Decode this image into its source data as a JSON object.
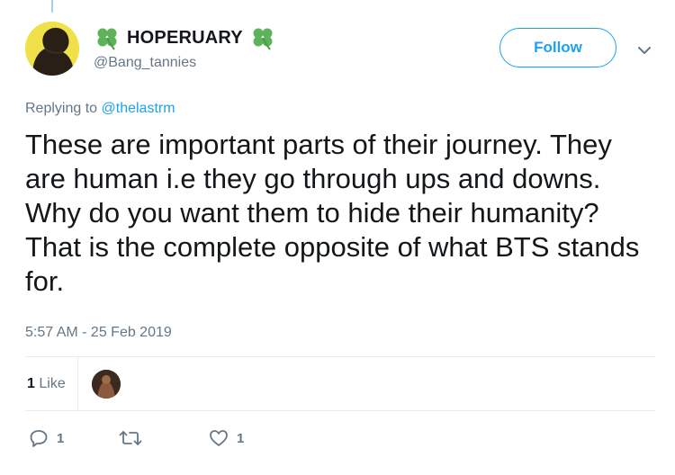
{
  "user": {
    "display_name": "HOPERUARY",
    "handle": "@Bang_tannies",
    "avatar_icon": "avatar-silhouette",
    "emoji_icon": "four-leaf-clover-icon"
  },
  "follow_button": {
    "label": "Follow"
  },
  "menu": {
    "icon": "chevron-down-icon"
  },
  "reply": {
    "prefix": "Replying to",
    "mention": "@thelastrm"
  },
  "tweet": {
    "text": "These are important parts of their journey. They are human i.e they go through ups and downs. Why do you want them to hide their humanity? That is the complete opposite of what BTS stands for.",
    "timestamp": "5:57 AM - 25 Feb 2019"
  },
  "likes": {
    "count": "1",
    "label": "Like"
  },
  "actions": {
    "reply_count": "1",
    "retweet_count": "",
    "like_count": "1"
  },
  "colors": {
    "accent": "#1da1f2",
    "secondary_text": "#657786",
    "primary_text": "#14171a",
    "divider": "#e6ecf0",
    "clover_green": "#5eb35a"
  }
}
